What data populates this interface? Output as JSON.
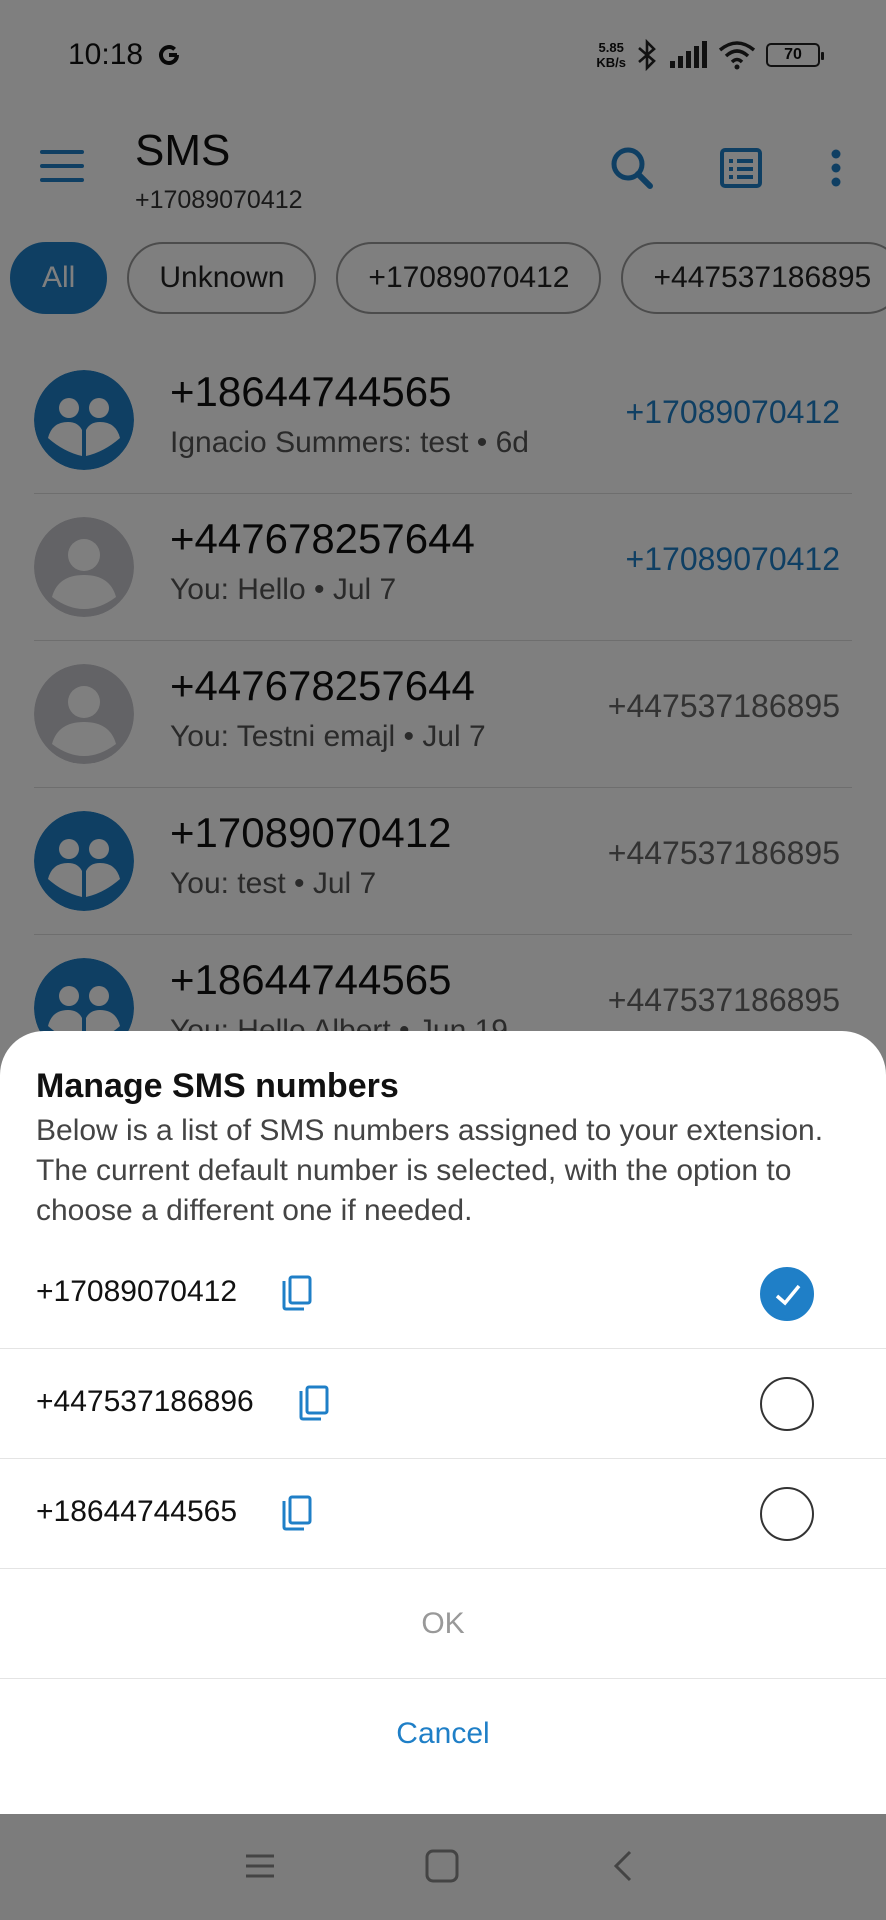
{
  "status_bar": {
    "time": "10:18",
    "net_speed_value": "5.85",
    "net_speed_unit": "KB/s",
    "battery": "70"
  },
  "app_bar": {
    "title": "SMS",
    "subtitle": "+17089070412"
  },
  "filters": [
    {
      "label": "All",
      "active": true
    },
    {
      "label": "Unknown",
      "active": false
    },
    {
      "label": "+17089070412",
      "active": false
    },
    {
      "label": "+447537186895",
      "active": false
    }
  ],
  "conversations": [
    {
      "name": "+18644744565",
      "preview": "Ignacio Summers: test • 6d",
      "via": "+17089070412",
      "avatar": "group-icon"
    },
    {
      "name": "+447678257644",
      "preview": "You: Hello • Jul 7",
      "via": "+17089070412",
      "avatar": "person-icon"
    },
    {
      "name": "+447678257644",
      "preview": "You: Testni emajl • Jul 7",
      "via": "+447537186895",
      "avatar": "person-icon"
    },
    {
      "name": "+17089070412",
      "preview": "You: test • Jul 7",
      "via": "+447537186895",
      "avatar": "group-icon"
    },
    {
      "name": "+18644744565",
      "preview": "You: Hello Albert • Jun 19",
      "via": "+447537186895",
      "avatar": "group-icon"
    }
  ],
  "sheet": {
    "title": "Manage SMS numbers",
    "description": "Below is a list of SMS numbers assigned to your extension. The current default number is selected, with the option to choose a different one if needed.",
    "numbers": [
      {
        "number": "+17089070412",
        "selected": true
      },
      {
        "number": "+447537186896",
        "selected": false
      },
      {
        "number": "+18644744565",
        "selected": false
      }
    ],
    "ok_label": "OK",
    "cancel_label": "Cancel"
  },
  "colors": {
    "accent": "#1f7fc7",
    "via_default": "#1f7fc7",
    "via_other": "#666666",
    "disabled": "#999999"
  }
}
